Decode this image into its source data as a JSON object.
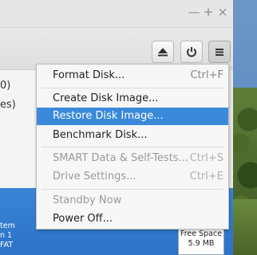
{
  "window": {
    "controls": [
      {
        "name": "close-button",
        "glyph": "—"
      },
      {
        "name": "maximize-button",
        "glyph": "+"
      },
      {
        "name": "minimize-button",
        "glyph": "×"
      }
    ]
  },
  "toolbar": {
    "eject_icon": "eject-icon",
    "power_icon": "power-icon",
    "menu_icon": "menu-icon"
  },
  "sidebar": {
    "fragments": [
      "0)",
      "es)"
    ]
  },
  "strip": {
    "lines": [
      "tem",
      "n 1",
      "FAT"
    ]
  },
  "free_space": {
    "label": "Free Space",
    "value": "5.9 MB"
  },
  "menu": {
    "items": [
      {
        "label": "Format Disk...",
        "accel": "Ctrl+F",
        "enabled": true
      },
      {
        "label": "Create Disk Image...",
        "accel": "",
        "enabled": true
      },
      {
        "label": "Restore Disk Image...",
        "accel": "",
        "enabled": true,
        "highlighted": true
      },
      {
        "label": "Benchmark Disk...",
        "accel": "",
        "enabled": true
      },
      {
        "label": "SMART Data & Self-Tests...",
        "accel": "Ctrl+S",
        "enabled": false
      },
      {
        "label": "Drive Settings...",
        "accel": "Ctrl+E",
        "enabled": false
      },
      {
        "label": "Standby Now",
        "accel": "",
        "enabled": false
      },
      {
        "label": "Power Off...",
        "accel": "",
        "enabled": true
      }
    ]
  },
  "colors": {
    "highlight": "#3b89da",
    "strip": "#2d73c7"
  }
}
